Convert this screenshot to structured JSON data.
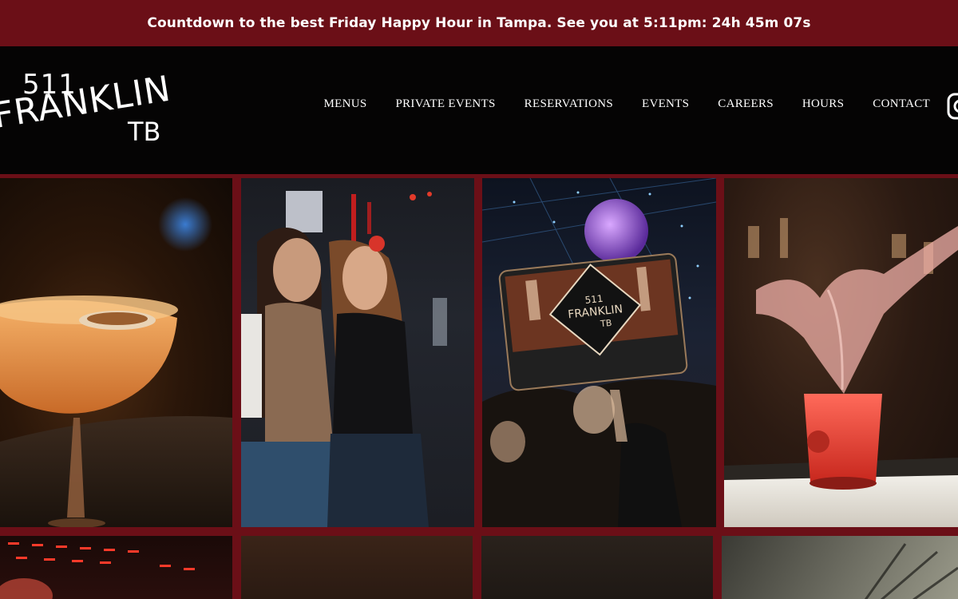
{
  "announcement": {
    "text": "Countdown to the best Friday Happy Hour in Tampa. See you at 5:11pm: 24h 45m 07s"
  },
  "logo": {
    "line1": "511",
    "line2": "FRANKLIN",
    "line3": "TB"
  },
  "nav": {
    "items": [
      {
        "label": "MENUS"
      },
      {
        "label": "PRIVATE EVENTS"
      },
      {
        "label": "RESERVATIONS"
      },
      {
        "label": "EVENTS"
      },
      {
        "label": "CAREERS"
      },
      {
        "label": "HOURS"
      },
      {
        "label": "CONTACT"
      }
    ]
  },
  "photos": {
    "sign_line1": "511",
    "sign_line2": "FRANKLIN",
    "sign_line3": "TB"
  },
  "colors": {
    "brand_maroon": "#6b0f17",
    "header_black": "#050404",
    "text_white": "#ffffff"
  }
}
